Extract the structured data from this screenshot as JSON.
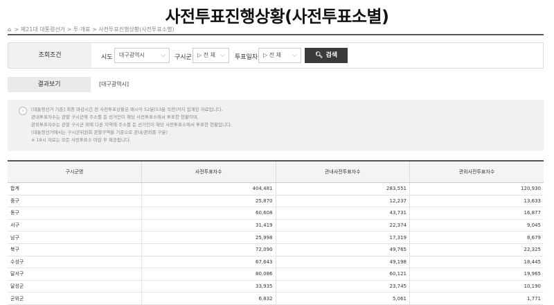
{
  "page": {
    "title": "사전투표진행상황(사전투표소별)",
    "breadcrumb": [
      "제21대 대통령선거",
      "투·개표",
      "사전투표진행상황(사전투표소별)"
    ],
    "breadcrumb_sep": ">"
  },
  "search": {
    "label": "조회조건",
    "sido_label": "시도",
    "sido_value": "대구광역시",
    "sigungu_label": "구시군",
    "sigungu_value": "▷ 전 체",
    "date_label": "투표일자",
    "date_value": "▷ 전 체",
    "button_label": "검색"
  },
  "result": {
    "label": "결과보기",
    "value": "[대구광역시]"
  },
  "notice": {
    "lines": [
      "[대통령선거 기준] 최종 마감시간 전 사전투표상황은 매시각 52분(53분 직전)까지 집계된 자료입니다.",
      "관내투표자수는 관할 구시군에 주소를 둔 선거인이 해당 사전투표소에서 투표한 현황이며,",
      "관외투표자수는 관할 구시군 외에 다른 지역에 주소를 둔 선거인이 해당 사전투표소에서 투표한 현황입니다.",
      "(대통령선거에서는 구시군위원회 관할구역을 기준으로 관내/관외를 구분)",
      "※ 18시 자료는 모든 사전투표소 마감 후 제공됩니다."
    ]
  },
  "table": {
    "headers": [
      "구시군명",
      "사전투표자수",
      "관내사전투표자수",
      "관외사전투표자수"
    ],
    "rows": [
      [
        "합계",
        "404,481",
        "283,551",
        "120,930"
      ],
      [
        "중구",
        "25,870",
        "12,237",
        "13,633"
      ],
      [
        "동구",
        "60,608",
        "43,731",
        "16,877"
      ],
      [
        "서구",
        "31,419",
        "22,374",
        "9,045"
      ],
      [
        "남구",
        "25,998",
        "17,319",
        "8,679"
      ],
      [
        "북구",
        "72,090",
        "49,765",
        "22,325"
      ],
      [
        "수성구",
        "67,643",
        "49,198",
        "18,445"
      ],
      [
        "달서구",
        "80,086",
        "60,121",
        "19,965"
      ],
      [
        "달성군",
        "33,935",
        "23,745",
        "10,190"
      ],
      [
        "군위군",
        "6,832",
        "5,061",
        "1,771"
      ]
    ]
  }
}
